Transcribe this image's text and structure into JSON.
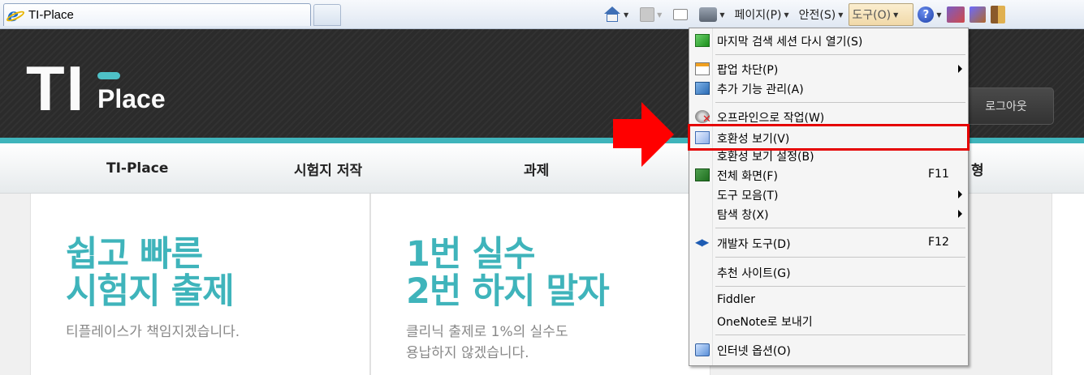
{
  "browser": {
    "tab_title": "TI-Place",
    "commands": {
      "page": "페이지(P)",
      "safety": "안전(S)",
      "tools": "도구(O)",
      "help_glyph": "?"
    },
    "icons": [
      "home-icon",
      "feeds-icon",
      "read-mail-icon",
      "print-icon",
      "help-icon",
      "research-icon",
      "extension-icon",
      "exit-icon"
    ]
  },
  "site": {
    "logo_main": "TI",
    "logo_sub": "Place",
    "logout": "로그아웃",
    "nav": [
      "TI-Place",
      "시험지 저작",
      "과제"
    ],
    "nav_partial": "형",
    "cards": [
      {
        "headline_1": "쉽고 빠른",
        "headline_2": "시험지 출제",
        "sub_1": "티플레이스가 책임지겠습니다.",
        "sub_2": ""
      },
      {
        "headline_1": "1번 실수",
        "headline_2": "2번 하지 말자",
        "sub_1": "클리닉 출제로 1%의 실수도",
        "sub_2": "용납하지 않겠습니다."
      }
    ],
    "accent_color": "#3fb4bb"
  },
  "tools_menu": {
    "items": [
      {
        "label": "마지막 검색 세션 다시 열기(S)",
        "icon": "reopen-session-icon"
      },
      {
        "label": "팝업 차단(P)",
        "icon": "popup-blocker-icon",
        "submenu": true
      },
      {
        "label": "추가 기능 관리(A)",
        "icon": "manage-addons-icon"
      },
      {
        "label": "오프라인으로 작업(W)",
        "icon": "work-offline-icon"
      },
      {
        "label": "호환성 보기(V)",
        "icon": "compatibility-view-icon",
        "highlighted": true
      },
      {
        "label": "호환성 보기 설정(B)"
      },
      {
        "label": "전체 화면(F)",
        "icon": "full-screen-icon",
        "shortcut": "F11"
      },
      {
        "label": "도구 모음(T)",
        "submenu": true
      },
      {
        "label": "탐색 창(X)",
        "submenu": true
      },
      {
        "label": "개발자 도구(D)",
        "icon": "developer-tools-icon",
        "shortcut": "F12"
      },
      {
        "label": "추천 사이트(G)"
      },
      {
        "label": "Fiddler"
      },
      {
        "label": "OneNote로 보내기"
      },
      {
        "label": "인터넷 옵션(O)",
        "icon": "internet-options-icon"
      }
    ]
  },
  "annotation": {
    "highlight_color": "#e50000",
    "arrow_color": "#ff0000"
  }
}
